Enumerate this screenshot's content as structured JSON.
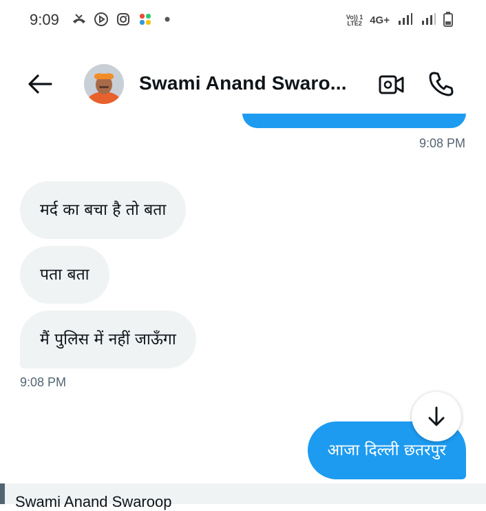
{
  "status_bar": {
    "time": "9:09",
    "icons_left": [
      "missed-call-icon",
      "play-icon",
      "instagram-icon",
      "pinwheel-icon",
      "dot-icon"
    ],
    "volte_line1": "Vo)) 1",
    "volte_line2": "LTE2",
    "network": "4G+",
    "icons_right": [
      "signal-icon",
      "signal-icon",
      "battery-icon"
    ]
  },
  "header": {
    "contact_name": "Swami Anand Swaro...",
    "icons": [
      "back-arrow-icon",
      "video-call-icon",
      "phone-icon"
    ]
  },
  "chat": {
    "sent_timestamp_top": "9:08 PM",
    "received": [
      {
        "text": "मर्द का बचा है तो बता"
      },
      {
        "text": "पता बता"
      },
      {
        "text": "मैं पुलिस में नहीं जाऊँगा"
      }
    ],
    "received_timestamp": "9:08 PM",
    "sent": [
      {
        "text": "आजा दिल्ली छतरपुर"
      }
    ],
    "scroll_down_icon": "arrow-down-icon"
  },
  "reply_bar": {
    "name": "Swami Anand Swaroop"
  },
  "colors": {
    "accent": "#1d9bf0",
    "received_bubble": "#eff3f4",
    "muted_text": "#536471"
  }
}
